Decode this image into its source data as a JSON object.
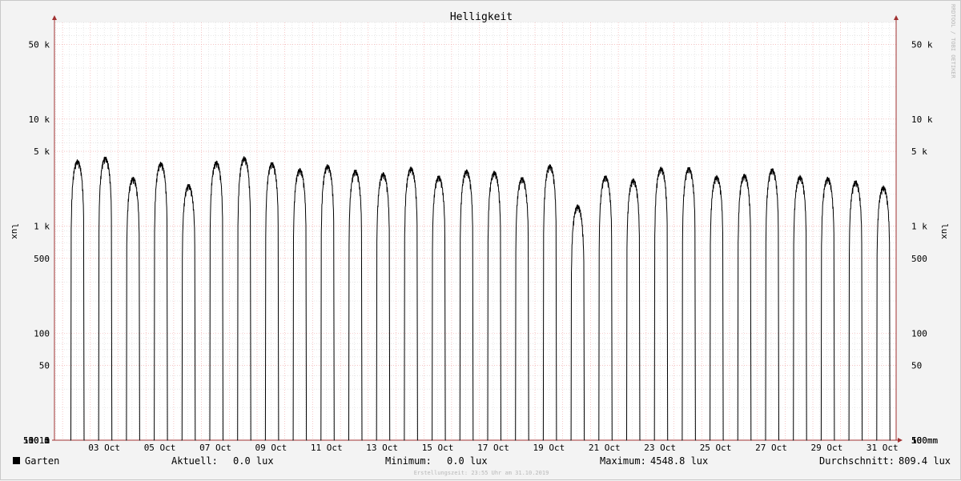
{
  "chart_data": {
    "type": "line",
    "title": "Helligkeit",
    "ylabel": "lux",
    "ylabel_right": "lux",
    "yscale": "log",
    "ylim": [
      10,
      80000
    ],
    "xlim": [
      "2019-10-01 17:00",
      "2019-10-31 23:55"
    ],
    "grid": true,
    "y_ticks": [
      {
        "value": 10,
        "label": "10 m"
      },
      {
        "value": 50,
        "label": "50 m"
      },
      {
        "value": 100,
        "label": "100 m"
      },
      {
        "value": 500,
        "label": "500 m"
      },
      {
        "value": 1000,
        "label": "1"
      },
      {
        "value": 5000,
        "label": "5"
      },
      {
        "value": 10000,
        "label": "10"
      },
      {
        "value": 50000,
        "label": "50"
      },
      {
        "value": 100000,
        "label": "100"
      },
      {
        "value": 500000,
        "label": "500"
      },
      {
        "value": 1000000,
        "label": "1 k"
      },
      {
        "value": 5000000,
        "label": "5 k"
      },
      {
        "value": 10000000,
        "label": "10 k"
      },
      {
        "value": 50000000,
        "label": "50 k"
      }
    ],
    "x_ticks": [
      {
        "value": "2019-10-03",
        "label": "03 Oct"
      },
      {
        "value": "2019-10-05",
        "label": "05 Oct"
      },
      {
        "value": "2019-10-07",
        "label": "07 Oct"
      },
      {
        "value": "2019-10-09",
        "label": "09 Oct"
      },
      {
        "value": "2019-10-11",
        "label": "11 Oct"
      },
      {
        "value": "2019-10-13",
        "label": "13 Oct"
      },
      {
        "value": "2019-10-15",
        "label": "15 Oct"
      },
      {
        "value": "2019-10-17",
        "label": "17 Oct"
      },
      {
        "value": "2019-10-19",
        "label": "19 Oct"
      },
      {
        "value": "2019-10-21",
        "label": "21 Oct"
      },
      {
        "value": "2019-10-23",
        "label": "23 Oct"
      },
      {
        "value": "2019-10-25",
        "label": "25 Oct"
      },
      {
        "value": "2019-10-27",
        "label": "27 Oct"
      },
      {
        "value": "2019-10-29",
        "label": "29 Oct"
      },
      {
        "value": "2019-10-31",
        "label": "31 Oct"
      }
    ],
    "series": [
      {
        "name": "Garten",
        "color": "#000000",
        "daily": [
          {
            "date": "2019-10-02",
            "peak": 4200
          },
          {
            "date": "2019-10-03",
            "peak": 4500
          },
          {
            "date": "2019-10-04",
            "peak": 2900
          },
          {
            "date": "2019-10-05",
            "peak": 4000
          },
          {
            "date": "2019-10-06",
            "peak": 2500
          },
          {
            "date": "2019-10-07",
            "peak": 4100
          },
          {
            "date": "2019-10-08",
            "peak": 4500
          },
          {
            "date": "2019-10-09",
            "peak": 4000
          },
          {
            "date": "2019-10-10",
            "peak": 3500
          },
          {
            "date": "2019-10-11",
            "peak": 3800
          },
          {
            "date": "2019-10-12",
            "peak": 3400
          },
          {
            "date": "2019-10-13",
            "peak": 3200
          },
          {
            "date": "2019-10-14",
            "peak": 3600
          },
          {
            "date": "2019-10-15",
            "peak": 3000
          },
          {
            "date": "2019-10-16",
            "peak": 3400
          },
          {
            "date": "2019-10-17",
            "peak": 3300
          },
          {
            "date": "2019-10-18",
            "peak": 2900
          },
          {
            "date": "2019-10-19",
            "peak": 3800
          },
          {
            "date": "2019-10-20",
            "peak": 1600
          },
          {
            "date": "2019-10-21",
            "peak": 3000
          },
          {
            "date": "2019-10-22",
            "peak": 2800
          },
          {
            "date": "2019-10-23",
            "peak": 3600
          },
          {
            "date": "2019-10-24",
            "peak": 3600
          },
          {
            "date": "2019-10-25",
            "peak": 3000
          },
          {
            "date": "2019-10-26",
            "peak": 3100
          },
          {
            "date": "2019-10-27",
            "peak": 3500
          },
          {
            "date": "2019-10-28",
            "peak": 3000
          },
          {
            "date": "2019-10-29",
            "peak": 2900
          },
          {
            "date": "2019-10-30",
            "peak": 2700
          },
          {
            "date": "2019-10-31",
            "peak": 2400
          }
        ]
      }
    ]
  },
  "legend": {
    "name": "Garten",
    "color": "#000000",
    "current_label": "Aktuell:",
    "current_value": "0.0 lux",
    "min_label": "Minimum:",
    "min_value": "0.0 lux",
    "max_label": "Maximum:",
    "max_value": "4548.8 lux",
    "avg_label": "Durchschnitt:",
    "avg_value": "809.4 lux"
  },
  "watermark": "RRDTOOL / TOBI OETIKER",
  "created": "Erstellungszeit: 23:55 Uhr am 31.10.2019",
  "colors": {
    "background": "#f3f3f3",
    "canvas": "#ffffff",
    "grid_minor": "#d8d8d8",
    "grid_major": "#f0a0a0",
    "axis": "#a03030"
  }
}
